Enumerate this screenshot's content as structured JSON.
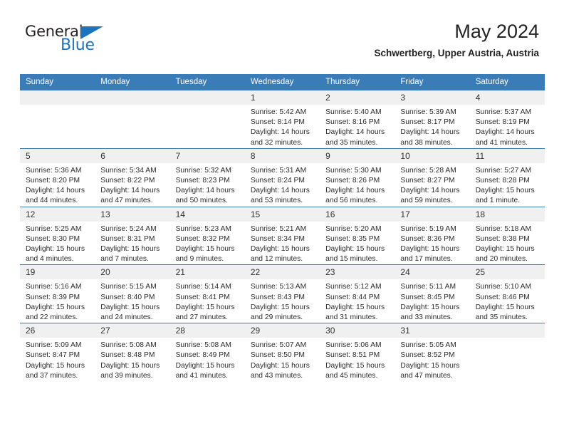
{
  "logo": {
    "word_top": "General",
    "word_bottom": "Blue",
    "accent_color": "#1b74bd"
  },
  "header": {
    "month_title": "May 2024",
    "location": "Schwertberg, Upper Austria, Austria"
  },
  "theme": {
    "header_blue": "#3a7cb8",
    "daynum_band": "#f0f0f0",
    "text": "#2b2b2b"
  },
  "calendar": {
    "weekday_headers": [
      "Sunday",
      "Monday",
      "Tuesday",
      "Wednesday",
      "Thursday",
      "Friday",
      "Saturday"
    ],
    "weeks": [
      [
        {
          "day": "",
          "sunrise": "",
          "sunset": "",
          "daylight_a": "",
          "daylight_b": ""
        },
        {
          "day": "",
          "sunrise": "",
          "sunset": "",
          "daylight_a": "",
          "daylight_b": ""
        },
        {
          "day": "",
          "sunrise": "",
          "sunset": "",
          "daylight_a": "",
          "daylight_b": ""
        },
        {
          "day": "1",
          "sunrise": "Sunrise: 5:42 AM",
          "sunset": "Sunset: 8:14 PM",
          "daylight_a": "Daylight: 14 hours",
          "daylight_b": "and 32 minutes."
        },
        {
          "day": "2",
          "sunrise": "Sunrise: 5:40 AM",
          "sunset": "Sunset: 8:16 PM",
          "daylight_a": "Daylight: 14 hours",
          "daylight_b": "and 35 minutes."
        },
        {
          "day": "3",
          "sunrise": "Sunrise: 5:39 AM",
          "sunset": "Sunset: 8:17 PM",
          "daylight_a": "Daylight: 14 hours",
          "daylight_b": "and 38 minutes."
        },
        {
          "day": "4",
          "sunrise": "Sunrise: 5:37 AM",
          "sunset": "Sunset: 8:19 PM",
          "daylight_a": "Daylight: 14 hours",
          "daylight_b": "and 41 minutes."
        }
      ],
      [
        {
          "day": "5",
          "sunrise": "Sunrise: 5:36 AM",
          "sunset": "Sunset: 8:20 PM",
          "daylight_a": "Daylight: 14 hours",
          "daylight_b": "and 44 minutes."
        },
        {
          "day": "6",
          "sunrise": "Sunrise: 5:34 AM",
          "sunset": "Sunset: 8:22 PM",
          "daylight_a": "Daylight: 14 hours",
          "daylight_b": "and 47 minutes."
        },
        {
          "day": "7",
          "sunrise": "Sunrise: 5:32 AM",
          "sunset": "Sunset: 8:23 PM",
          "daylight_a": "Daylight: 14 hours",
          "daylight_b": "and 50 minutes."
        },
        {
          "day": "8",
          "sunrise": "Sunrise: 5:31 AM",
          "sunset": "Sunset: 8:24 PM",
          "daylight_a": "Daylight: 14 hours",
          "daylight_b": "and 53 minutes."
        },
        {
          "day": "9",
          "sunrise": "Sunrise: 5:30 AM",
          "sunset": "Sunset: 8:26 PM",
          "daylight_a": "Daylight: 14 hours",
          "daylight_b": "and 56 minutes."
        },
        {
          "day": "10",
          "sunrise": "Sunrise: 5:28 AM",
          "sunset": "Sunset: 8:27 PM",
          "daylight_a": "Daylight: 14 hours",
          "daylight_b": "and 59 minutes."
        },
        {
          "day": "11",
          "sunrise": "Sunrise: 5:27 AM",
          "sunset": "Sunset: 8:28 PM",
          "daylight_a": "Daylight: 15 hours",
          "daylight_b": "and 1 minute."
        }
      ],
      [
        {
          "day": "12",
          "sunrise": "Sunrise: 5:25 AM",
          "sunset": "Sunset: 8:30 PM",
          "daylight_a": "Daylight: 15 hours",
          "daylight_b": "and 4 minutes."
        },
        {
          "day": "13",
          "sunrise": "Sunrise: 5:24 AM",
          "sunset": "Sunset: 8:31 PM",
          "daylight_a": "Daylight: 15 hours",
          "daylight_b": "and 7 minutes."
        },
        {
          "day": "14",
          "sunrise": "Sunrise: 5:23 AM",
          "sunset": "Sunset: 8:32 PM",
          "daylight_a": "Daylight: 15 hours",
          "daylight_b": "and 9 minutes."
        },
        {
          "day": "15",
          "sunrise": "Sunrise: 5:21 AM",
          "sunset": "Sunset: 8:34 PM",
          "daylight_a": "Daylight: 15 hours",
          "daylight_b": "and 12 minutes."
        },
        {
          "day": "16",
          "sunrise": "Sunrise: 5:20 AM",
          "sunset": "Sunset: 8:35 PM",
          "daylight_a": "Daylight: 15 hours",
          "daylight_b": "and 15 minutes."
        },
        {
          "day": "17",
          "sunrise": "Sunrise: 5:19 AM",
          "sunset": "Sunset: 8:36 PM",
          "daylight_a": "Daylight: 15 hours",
          "daylight_b": "and 17 minutes."
        },
        {
          "day": "18",
          "sunrise": "Sunrise: 5:18 AM",
          "sunset": "Sunset: 8:38 PM",
          "daylight_a": "Daylight: 15 hours",
          "daylight_b": "and 20 minutes."
        }
      ],
      [
        {
          "day": "19",
          "sunrise": "Sunrise: 5:16 AM",
          "sunset": "Sunset: 8:39 PM",
          "daylight_a": "Daylight: 15 hours",
          "daylight_b": "and 22 minutes."
        },
        {
          "day": "20",
          "sunrise": "Sunrise: 5:15 AM",
          "sunset": "Sunset: 8:40 PM",
          "daylight_a": "Daylight: 15 hours",
          "daylight_b": "and 24 minutes."
        },
        {
          "day": "21",
          "sunrise": "Sunrise: 5:14 AM",
          "sunset": "Sunset: 8:41 PM",
          "daylight_a": "Daylight: 15 hours",
          "daylight_b": "and 27 minutes."
        },
        {
          "day": "22",
          "sunrise": "Sunrise: 5:13 AM",
          "sunset": "Sunset: 8:43 PM",
          "daylight_a": "Daylight: 15 hours",
          "daylight_b": "and 29 minutes."
        },
        {
          "day": "23",
          "sunrise": "Sunrise: 5:12 AM",
          "sunset": "Sunset: 8:44 PM",
          "daylight_a": "Daylight: 15 hours",
          "daylight_b": "and 31 minutes."
        },
        {
          "day": "24",
          "sunrise": "Sunrise: 5:11 AM",
          "sunset": "Sunset: 8:45 PM",
          "daylight_a": "Daylight: 15 hours",
          "daylight_b": "and 33 minutes."
        },
        {
          "day": "25",
          "sunrise": "Sunrise: 5:10 AM",
          "sunset": "Sunset: 8:46 PM",
          "daylight_a": "Daylight: 15 hours",
          "daylight_b": "and 35 minutes."
        }
      ],
      [
        {
          "day": "26",
          "sunrise": "Sunrise: 5:09 AM",
          "sunset": "Sunset: 8:47 PM",
          "daylight_a": "Daylight: 15 hours",
          "daylight_b": "and 37 minutes."
        },
        {
          "day": "27",
          "sunrise": "Sunrise: 5:08 AM",
          "sunset": "Sunset: 8:48 PM",
          "daylight_a": "Daylight: 15 hours",
          "daylight_b": "and 39 minutes."
        },
        {
          "day": "28",
          "sunrise": "Sunrise: 5:08 AM",
          "sunset": "Sunset: 8:49 PM",
          "daylight_a": "Daylight: 15 hours",
          "daylight_b": "and 41 minutes."
        },
        {
          "day": "29",
          "sunrise": "Sunrise: 5:07 AM",
          "sunset": "Sunset: 8:50 PM",
          "daylight_a": "Daylight: 15 hours",
          "daylight_b": "and 43 minutes."
        },
        {
          "day": "30",
          "sunrise": "Sunrise: 5:06 AM",
          "sunset": "Sunset: 8:51 PM",
          "daylight_a": "Daylight: 15 hours",
          "daylight_b": "and 45 minutes."
        },
        {
          "day": "31",
          "sunrise": "Sunrise: 5:05 AM",
          "sunset": "Sunset: 8:52 PM",
          "daylight_a": "Daylight: 15 hours",
          "daylight_b": "and 47 minutes."
        },
        {
          "day": "",
          "sunrise": "",
          "sunset": "",
          "daylight_a": "",
          "daylight_b": ""
        }
      ]
    ]
  }
}
